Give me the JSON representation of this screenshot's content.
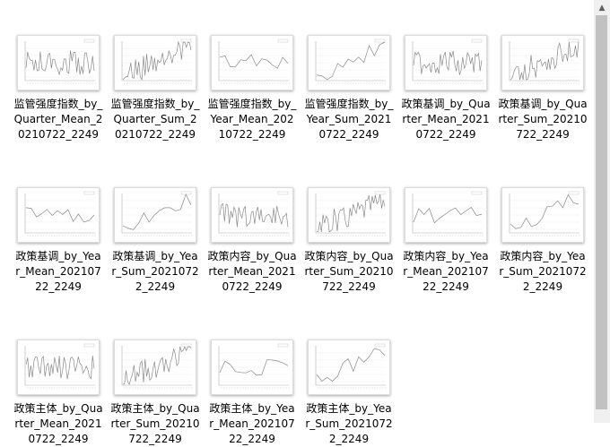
{
  "files": [
    {
      "name": "监管强度指数_by_Quarter_Mean_20210722_2249",
      "thumb": "quarter"
    },
    {
      "name": "监管强度指数_by_Quarter_Sum_20210722_2249",
      "thumb": "quarter-rising"
    },
    {
      "name": "监管强度指数_by_Year_Mean_20210722_2249",
      "thumb": "year"
    },
    {
      "name": "监管强度指数_by_Year_Sum_20210722_2249",
      "thumb": "year-rising"
    },
    {
      "name": "政策基调_by_Quarter_Mean_20210722_2249",
      "thumb": "quarter"
    },
    {
      "name": "政策基调_by_Quarter_Sum_20210722_2249",
      "thumb": "quarter-rising"
    },
    {
      "name": "政策基调_by_Year_Mean_20210722_2249",
      "thumb": "year"
    },
    {
      "name": "政策基调_by_Year_Sum_20210722_2249",
      "thumb": "year-rising"
    },
    {
      "name": "政策内容_by_Quarter_Mean_20210722_2249",
      "thumb": "quarter"
    },
    {
      "name": "政策内容_by_Quarter_Sum_20210722_2249",
      "thumb": "quarter-rising"
    },
    {
      "name": "政策内容_by_Year_Mean_20210722_2249",
      "thumb": "year"
    },
    {
      "name": "政策内容_by_Year_Sum_20210722_2249",
      "thumb": "year-rising"
    },
    {
      "name": "政策主体_by_Quarter_Mean_20210722_2249",
      "thumb": "quarter"
    },
    {
      "name": "政策主体_by_Quarter_Sum_20210722_2249",
      "thumb": "quarter-rising"
    },
    {
      "name": "政策主体_by_Year_Mean_20210722_2249",
      "thumb": "year"
    },
    {
      "name": "政策主体_by_Year_Sum_20210722_2249",
      "thumb": "year-rising"
    }
  ],
  "colors": {
    "line": "#8a8a8a",
    "grid": "#ececec",
    "axis": "#b0b0b0"
  },
  "scrollbar": {
    "up_icon": "chevron-up-icon"
  }
}
